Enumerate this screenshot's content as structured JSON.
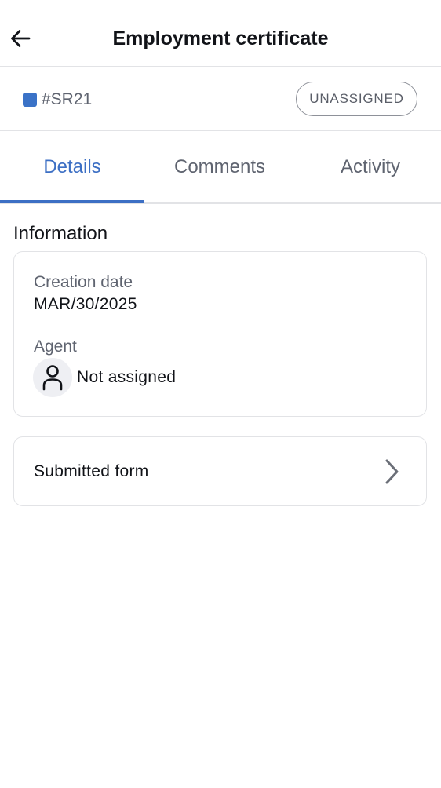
{
  "header": {
    "title": "Employment certificate",
    "back_icon": "arrow-left-icon"
  },
  "ticket": {
    "id": "#SR21",
    "swatch_color": "#3a72c7",
    "status": "UNASSIGNED"
  },
  "tabs": [
    {
      "label": "Details",
      "active": true
    },
    {
      "label": "Comments",
      "active": false
    },
    {
      "label": "Activity",
      "active": false
    }
  ],
  "colors": {
    "accent": "#3c6fc4",
    "muted_text": "#5f6470",
    "border": "#e2e3e6"
  },
  "information": {
    "title": "Information",
    "creation_date_label": "Creation date",
    "creation_date_value": "MAR/30/2025",
    "agent_label": "Agent",
    "agent_icon": "person-icon",
    "agent_value": "Not assigned"
  },
  "submitted_form": {
    "label": "Submitted form",
    "icon": "chevron-right-icon"
  }
}
